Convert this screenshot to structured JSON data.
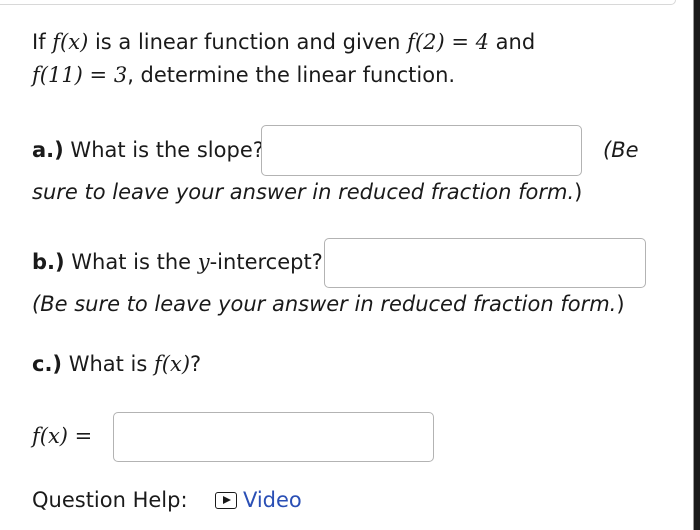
{
  "question": {
    "line1_prefix": "If ",
    "fx": "f(x)",
    "line1_mid": " is a linear function and given ",
    "f2": "f(2) = 4",
    "line1_suffix": " and",
    "f11": "f(11) = 3",
    "line2_suffix": ", determine the linear function."
  },
  "part_a": {
    "label": "a.)",
    "text": " What is the slope?",
    "note_start": "(Be",
    "note_rest": "sure to leave your answer in reduced fraction form.",
    "note_close": ")",
    "input_value": ""
  },
  "part_b": {
    "label": "b.)",
    "text_before": " What is the ",
    "y": "y",
    "text_after": "-intercept?",
    "note": "(Be sure to leave your answer in reduced fraction form.",
    "note_close": ")",
    "input_value": ""
  },
  "part_c": {
    "label": "c.)",
    "text": " What is ",
    "fx": "f(x)",
    "qmark": "?"
  },
  "answer": {
    "lhs": "f(x) =",
    "input_value": ""
  },
  "help": {
    "label": "Question Help:",
    "video": "Video"
  }
}
